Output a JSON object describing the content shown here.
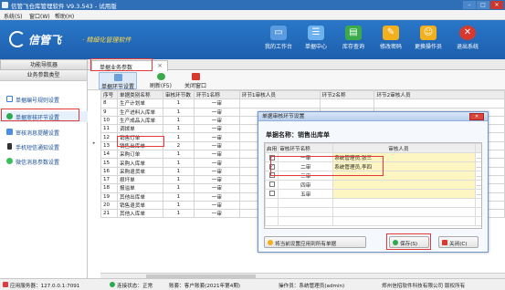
{
  "window": {
    "title": "信管飞仓库管理软件 V9.3.543 - 试用版",
    "min": "–",
    "max": "□",
    "close": "✕"
  },
  "menu": [
    "系统(S)",
    "窗口(W)",
    "帮助(H)"
  ],
  "brand": {
    "name": "信管飞",
    "dot": "·",
    "slogan": "精细化管理软件"
  },
  "toolbar": [
    {
      "label": "我的工作台",
      "icon": "monitor-icon",
      "color": "#5a9be0"
    },
    {
      "label": "单据中心",
      "icon": "documents-icon",
      "color": "#6db2ee"
    },
    {
      "label": "库存查询",
      "icon": "inventory-icon",
      "color": "#3aaa4a"
    },
    {
      "label": "修改密码",
      "icon": "key-icon",
      "color": "#f2b01e"
    },
    {
      "label": "更换操作员",
      "icon": "user-icon",
      "color": "#f2b01e"
    },
    {
      "label": "退出系统",
      "icon": "exit-icon",
      "color": "#d8382e"
    }
  ],
  "left_tab": "功能导航器",
  "main_tab": {
    "label": "单据业务参数",
    "close": "×"
  },
  "sidebar": {
    "header": "业务参数类型",
    "items": [
      {
        "label": "单据编号规则设置",
        "color": "#3b7dd8"
      },
      {
        "label": "单据审核环节设置",
        "color": "#2fa84f"
      },
      {
        "label": "审核消息提醒设置",
        "color": "#4a8fdc"
      },
      {
        "label": "手机短信通知设置",
        "color": "#333333"
      },
      {
        "label": "微信消息参数设置",
        "color": "#3bbf5a"
      }
    ]
  },
  "main_toolbar": [
    {
      "label": "单据环节设置",
      "color": "#6aa0dc"
    },
    {
      "label": "刷新(F5)",
      "color": "#3aaa4a"
    },
    {
      "label": "关闭窗口",
      "color": "#d8382e"
    }
  ],
  "grid": {
    "headers": [
      "序号",
      "单据类别名称",
      "审核环节数",
      "环节1名称",
      "环节1审核人员",
      "环节2名称",
      "环节2审核人员"
    ],
    "rows": [
      [
        "8",
        "生产计划单",
        "1",
        "一审"
      ],
      [
        "9",
        "生产进料入库单",
        "1",
        "一审"
      ],
      [
        "10",
        "生产成品入库单",
        "1",
        "一审"
      ],
      [
        "11",
        "调拨单",
        "1",
        "一审"
      ],
      [
        "12",
        "销售订单",
        "1",
        "一审"
      ],
      [
        "13",
        "销售出库单",
        "2",
        "一审"
      ],
      [
        "14",
        "采购订单",
        "1",
        "一审"
      ],
      [
        "15",
        "采购入库单",
        "1",
        "一审"
      ],
      [
        "16",
        "采购退货单",
        "1",
        "一审"
      ],
      [
        "17",
        "损坏单",
        "1",
        "一审"
      ],
      [
        "18",
        "报溢单",
        "1",
        "一审"
      ],
      [
        "19",
        "其他出库单",
        "1",
        "一审"
      ],
      [
        "20",
        "销售退货单",
        "1",
        "一审"
      ],
      [
        "21",
        "其他入库单",
        "1",
        "一审"
      ]
    ],
    "current_marker": "▸"
  },
  "dialog": {
    "title": "单据审核环节设置",
    "close": "✕",
    "heading": "单据名称：销售出库单",
    "headers": [
      "启用",
      "审核环节名称",
      "审核人员"
    ],
    "rows": [
      {
        "checked": true,
        "name": "一审",
        "staff": "系统管理员,张三"
      },
      {
        "checked": true,
        "name": "二审",
        "staff": "系统管理员,李四"
      },
      {
        "checked": false,
        "name": "三审",
        "staff": ""
      },
      {
        "checked": false,
        "name": "四审",
        "staff": ""
      },
      {
        "checked": false,
        "name": "五审",
        "staff": ""
      }
    ],
    "ellipsis": "...",
    "apply_all": "将当前设置应用到所有单据",
    "save": "保存(S)",
    "close_btn": "关闭(C)"
  },
  "status": {
    "app_label": "应用服务器：127.0.0.1:7091",
    "conn": "连接状态：正常",
    "account": "账套：客户账套(2021年第4期)",
    "operator": "操作员：系统管理员(admin)",
    "copyright": "郑州信招软件科技有限公司 版权所有"
  }
}
